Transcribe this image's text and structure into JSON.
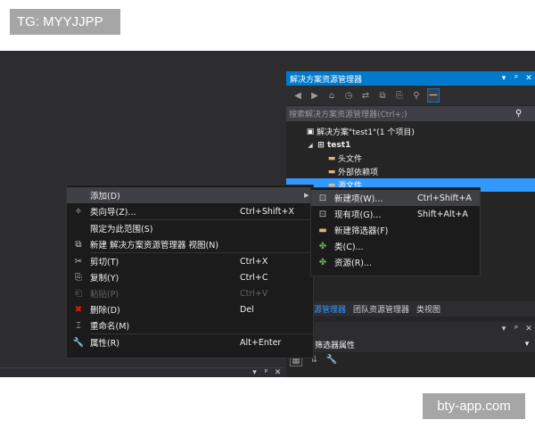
{
  "watermarks": {
    "top": "TG: MYYJJPP",
    "bottom": "bty-app.com"
  },
  "solution_explorer": {
    "title": "解决方案资源管理器",
    "pin": "ᵖ",
    "close": "✕",
    "dropdown": "▾",
    "search_placeholder": "搜索解决方案资源管理器(Ctrl+;)",
    "search_icon": "⚲",
    "toolbar": [
      "◀",
      "▶",
      "⌂",
      "◷",
      "⇄",
      "⧉",
      "⎘",
      "⚲",
      "—"
    ],
    "tree": [
      {
        "label": "解决方案\"test1\"(1 个项目)",
        "icon": "▣",
        "arrow": "",
        "indent": 0
      },
      {
        "label": "test1",
        "icon": "⊞",
        "arrow": "◢",
        "indent": 1,
        "bold": true
      },
      {
        "label": "头文件",
        "icon": "▬",
        "arrow": "",
        "indent": 2,
        "folder": true
      },
      {
        "label": "外部依赖项",
        "icon": "▬",
        "arrow": "",
        "indent": 2,
        "folder": true
      },
      {
        "label": "源文件",
        "icon": "▬",
        "arrow": "",
        "indent": 2,
        "folder": true,
        "selected": true
      }
    ],
    "tabs": [
      {
        "label": "方案资源管理器",
        "active": true
      },
      {
        "label": "团队资源管理器",
        "active": false
      },
      {
        "label": "类视图",
        "active": false
      }
    ]
  },
  "properties": {
    "row_label": "筛选器属性",
    "pin": "ᵖ",
    "close": "✕",
    "dropdown": "▾"
  },
  "bottom_panel": {
    "dropdown": "▾",
    "pin": "ᵖ",
    "close": "✕"
  },
  "context_menu": [
    {
      "type": "item",
      "icon": "",
      "label": "添加(D)",
      "shortcut": "",
      "submenu": true,
      "hover": true
    },
    {
      "type": "item",
      "icon": "✧",
      "label": "类向导(Z)...",
      "shortcut": "Ctrl+Shift+X"
    },
    {
      "type": "sep"
    },
    {
      "type": "item",
      "icon": "",
      "label": "限定为此范围(S)",
      "shortcut": ""
    },
    {
      "type": "item",
      "icon": "⧉",
      "label": "新建 解决方案资源管理器 视图(N)",
      "shortcut": ""
    },
    {
      "type": "sep"
    },
    {
      "type": "item",
      "icon": "✂",
      "label": "剪切(T)",
      "shortcut": "Ctrl+X"
    },
    {
      "type": "item",
      "icon": "⎘",
      "label": "复制(Y)",
      "shortcut": "Ctrl+C"
    },
    {
      "type": "item",
      "icon": "⎗",
      "label": "粘贴(P)",
      "shortcut": "Ctrl+V",
      "disabled": true
    },
    {
      "type": "item",
      "icon": "✖",
      "label": "删除(D)",
      "shortcut": "Del",
      "red": true
    },
    {
      "type": "item",
      "icon": "⌶",
      "label": "重命名(M)",
      "shortcut": ""
    },
    {
      "type": "sep"
    },
    {
      "type": "item",
      "icon": "🔧",
      "label": "属性(R)",
      "shortcut": "Alt+Enter"
    }
  ],
  "submenu": [
    {
      "icon": "⊡",
      "label": "新建项(W)...",
      "shortcut": "Ctrl+Shift+A",
      "hover": true
    },
    {
      "icon": "⊡",
      "label": "现有项(G)...",
      "shortcut": "Shift+Alt+A"
    },
    {
      "icon": "▬",
      "label": "新建筛选器(F)",
      "shortcut": "",
      "folder": true
    },
    {
      "icon": "✤",
      "label": "类(C)...",
      "shortcut": "",
      "green": true
    },
    {
      "icon": "✤",
      "label": "资源(R)...",
      "shortcut": "",
      "green": true
    }
  ]
}
